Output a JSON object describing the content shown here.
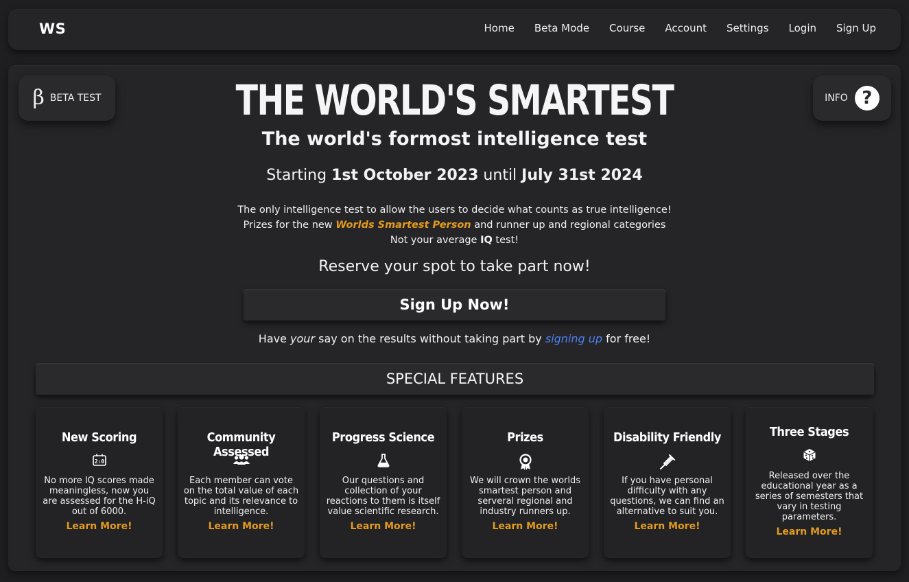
{
  "navbar": {
    "logo": "WS",
    "links": [
      "Home",
      "Beta Mode",
      "Course",
      "Account",
      "Settings",
      "Login",
      "Sign Up"
    ]
  },
  "beta_button": {
    "symbol": "β",
    "label": "BETA TEST",
    "icon": "beta-icon"
  },
  "info_button": {
    "label": "INFO",
    "icon": "question-icon"
  },
  "hero": {
    "title": "THE WORLD'S SMARTEST",
    "subtitle": "The world's formost intelligence test",
    "dates": {
      "prefix": "Starting ",
      "start": "1st October 2023",
      "middle": " until ",
      "end": "July 31st 2024"
    },
    "description": {
      "line1": "The only intelligence test to allow the users to decide what counts as true intelligence!",
      "line2_prefix": "Prizes for the new ",
      "line2_accent": "Worlds Smartest Person",
      "line2_suffix": " and runner up and regional categories",
      "line3_prefix": "Not your average ",
      "line3_bold": "IQ",
      "line3_suffix": " test!"
    },
    "reserve": "Reserve your spot to take part now!",
    "signup_button": "Sign Up Now!",
    "say": {
      "prefix": "Have ",
      "italic": "your",
      "middle": " say on the results without taking part by ",
      "link": "signing up",
      "suffix": " for free!"
    }
  },
  "features": {
    "heading": "SPECIAL FEATURES",
    "cards": [
      {
        "title": "New Scoring",
        "icon": "scoreboard-icon",
        "text": "No more IQ scores made meaningless, now you are assessed for the H-iQ out of 6000.",
        "more": "Learn More!"
      },
      {
        "title": "Community Assessed",
        "icon": "people-icon",
        "text": "Each member can vote on the total value of each topic and its relevance to intelligence.",
        "more": "Learn More!"
      },
      {
        "title": "Progress Science",
        "icon": "flask-icon",
        "text": "Our questions and collection of your reactions to them is itself value scientific research.",
        "more": "Learn More!"
      },
      {
        "title": "Prizes",
        "icon": "award-icon",
        "text": "We will crown the worlds smartest person and serveral regional and industry runners up.",
        "more": "Learn More!"
      },
      {
        "title": "Disability Friendly",
        "icon": "syringe-icon",
        "text": "If you have personal difficulty with any questions, we can find an alternative to suit you.",
        "more": "Learn More!"
      },
      {
        "title": "Three Stages",
        "icon": "dice-icon",
        "text": "Released over the educational year as a series of semesters that vary in testing parameters.",
        "more": "Learn More!"
      }
    ]
  }
}
